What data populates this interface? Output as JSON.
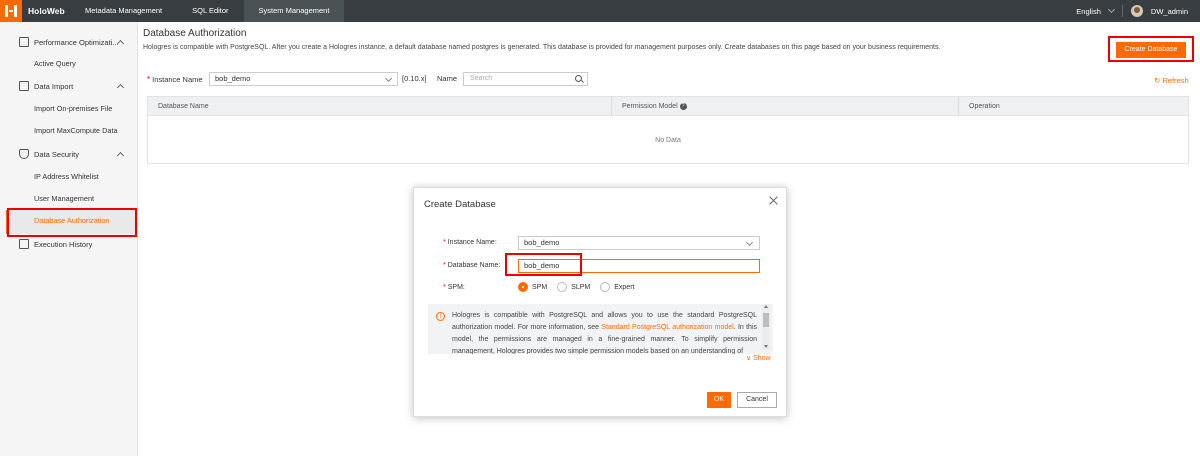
{
  "topbar": {
    "brand": "HoloWeb",
    "nav": [
      {
        "label": "Metadata Management"
      },
      {
        "label": "SQL Editor"
      },
      {
        "label": "System Management"
      }
    ],
    "language": "English",
    "user": "DW_admin"
  },
  "sidebar": {
    "groups": [
      {
        "label": "Performance Optimizati...",
        "icon": "chart-icon",
        "items": [
          {
            "label": "Active Query"
          }
        ]
      },
      {
        "label": "Data Import",
        "icon": "import-icon",
        "items": [
          {
            "label": "Import On-premises File"
          },
          {
            "label": "Import MaxCompute Data"
          }
        ]
      },
      {
        "label": "Data Security",
        "icon": "shield-icon",
        "items": [
          {
            "label": "IP Address Whitelist"
          },
          {
            "label": "User Management"
          },
          {
            "label": "Database Authorization"
          }
        ]
      },
      {
        "label": "Execution History",
        "icon": "history-icon",
        "items": []
      }
    ],
    "active": "Database Authorization"
  },
  "main": {
    "title": "Database Authorization",
    "description": "Hologres is compatible with PostgreSQL. After you create a Hologres instance, a default database named postgres is generated. This database is provided for management purposes only. Create databases on this page based on your business requirements.",
    "create_button": "Create Database",
    "instance_label": "Instance Name",
    "instance_value": "bob_demo",
    "version": "[0.10.x]",
    "name_label": "Name",
    "search_placeholder": "Search",
    "refresh": "Refresh",
    "table": {
      "columns": [
        "Database Name",
        "Permission Model",
        "Operation"
      ],
      "empty_text": "No Data"
    }
  },
  "modal": {
    "title": "Create Database",
    "instance_label": "Instance Name:",
    "instance_value": "bob_demo",
    "db_name_label": "Database Name:",
    "db_name_value": "bob_demo",
    "spm_label": "SPM:",
    "options": [
      "SPM",
      "SLPM",
      "Expert"
    ],
    "selected_option": "SPM",
    "info_text_before": "Hologres is compatible with PostgreSQL and allows you to use the standard PostgreSQL authorization model. For more information, see ",
    "info_link": "Standard PostgreSQL authorization model",
    "info_text_after": ". In this model, the permissions are managed in a fine-grained manner. To simplify permission management, Hologres provides two simple permission models based on an understanding of",
    "show": "Show",
    "ok": "OK",
    "cancel": "Cancel"
  },
  "colors": {
    "accent": "#ff6a00",
    "topbar": "#373d41",
    "highlight": "#ee0000"
  }
}
